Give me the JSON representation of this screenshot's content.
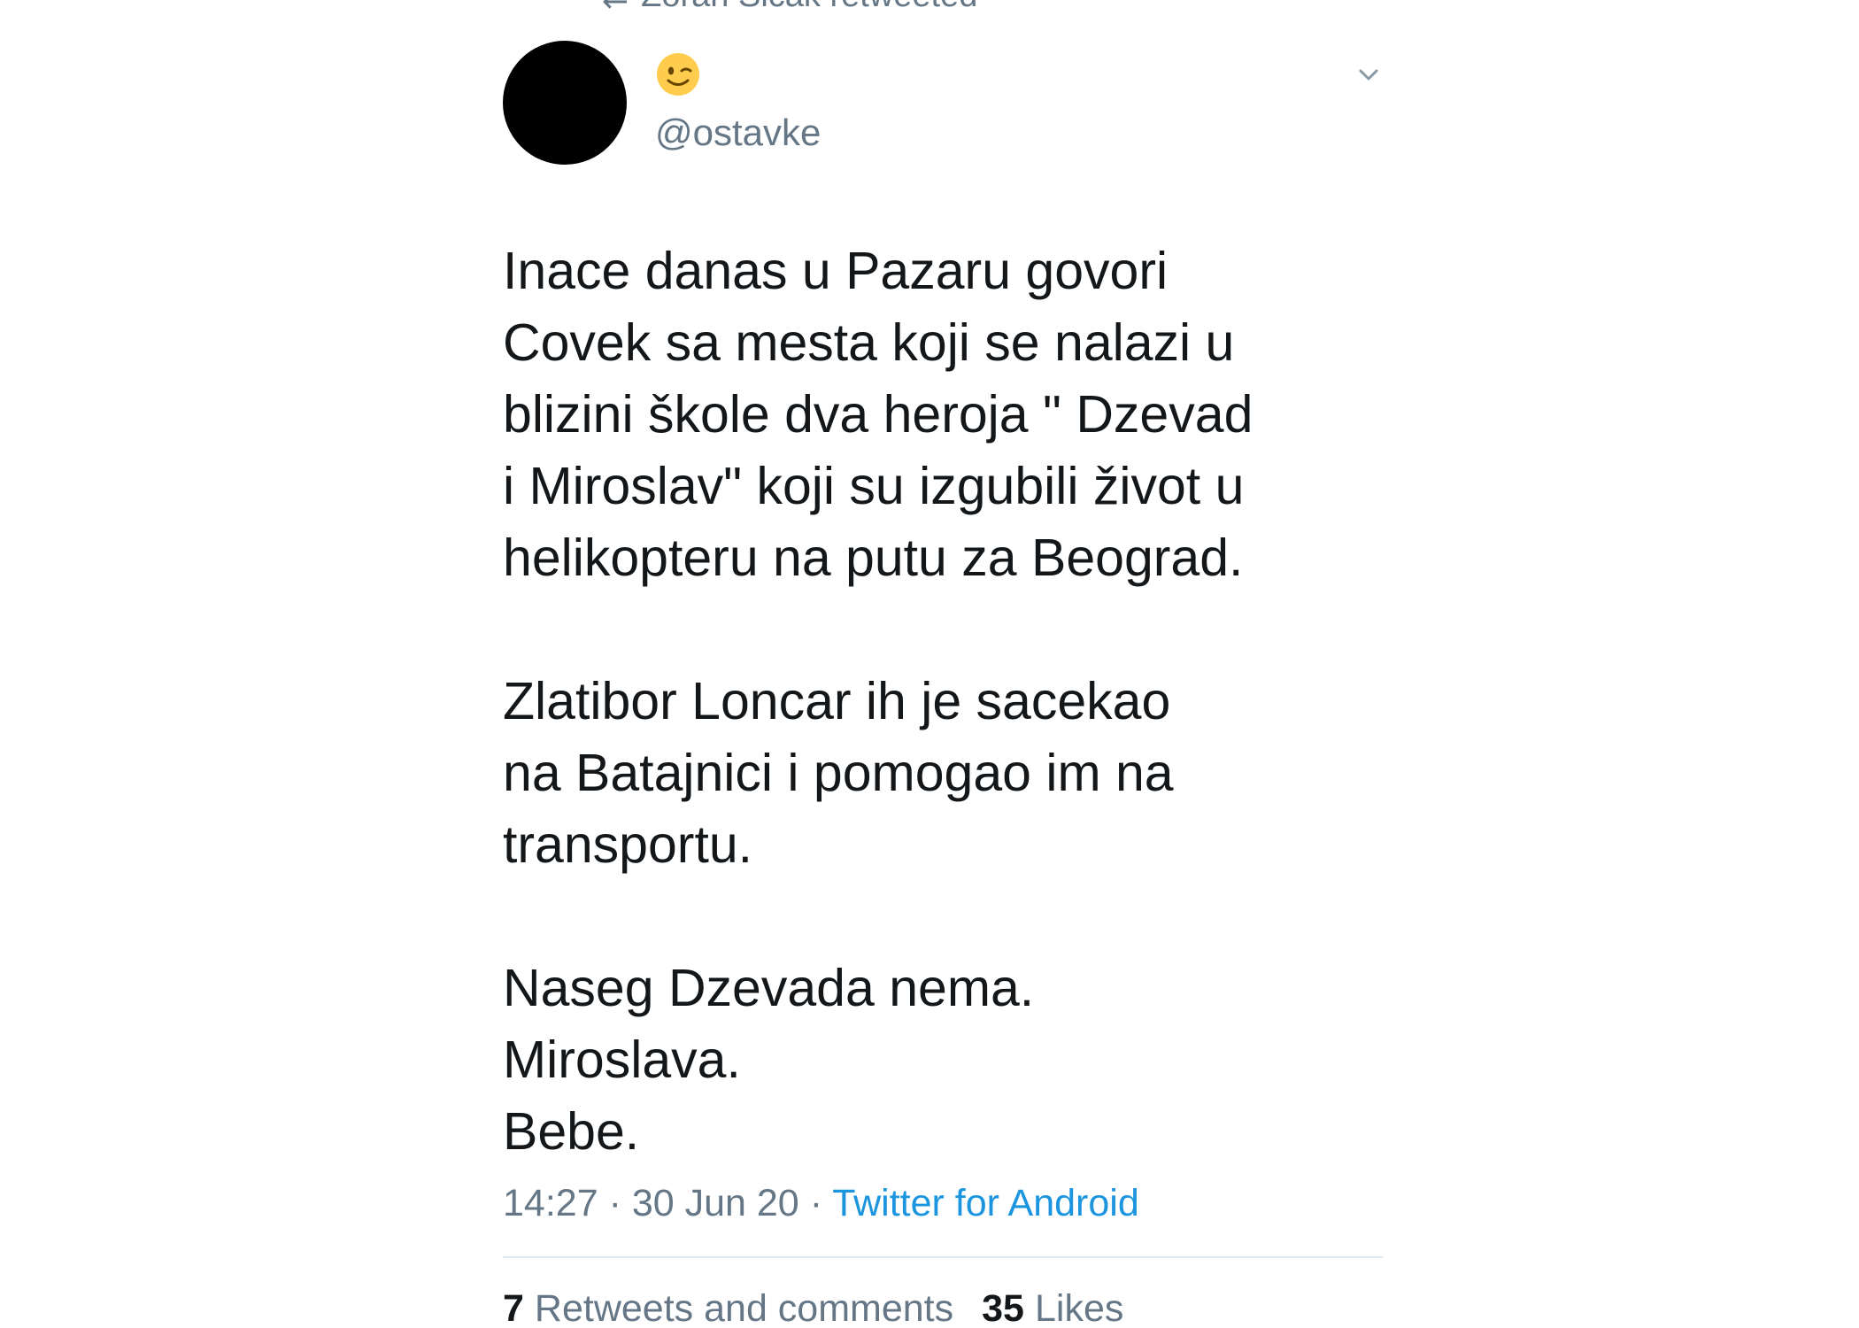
{
  "retweet_context": {
    "icon": "retweet-icon",
    "text": "Zoran Sicak retweeted"
  },
  "tweet": {
    "avatar": "avatar-blacked-out",
    "name_emoji": "winking-face-emoji",
    "handle": "@ostavke",
    "caret_icon": "chevron-down-icon",
    "paragraphs": [
      "Inace danas u Pazaru govori\nCovek sa mesta koji se nalazi u\nblizini škole dva heroja \" Dzevad\ni Miroslav\" koji su izgubili život u\nhelikopteru na putu za Beograd.",
      "Zlatibor Loncar ih je sacekao\nna Batajnici i pomogao im na\ntransportu.",
      "Naseg Dzevada nema.\nMiroslava.\nBebe."
    ],
    "time": "14:27",
    "separator": "·",
    "date": "30 Jun 20",
    "source": "Twitter for Android"
  },
  "stats": {
    "retweets_count": "7",
    "retweets_label": "Retweets and comments",
    "likes_count": "35",
    "likes_label": "Likes"
  },
  "colors": {
    "text": "#14171a",
    "secondary": "#657786",
    "link": "#1b95e0",
    "divider": "#e1e8ed",
    "avatar": "#000000"
  }
}
